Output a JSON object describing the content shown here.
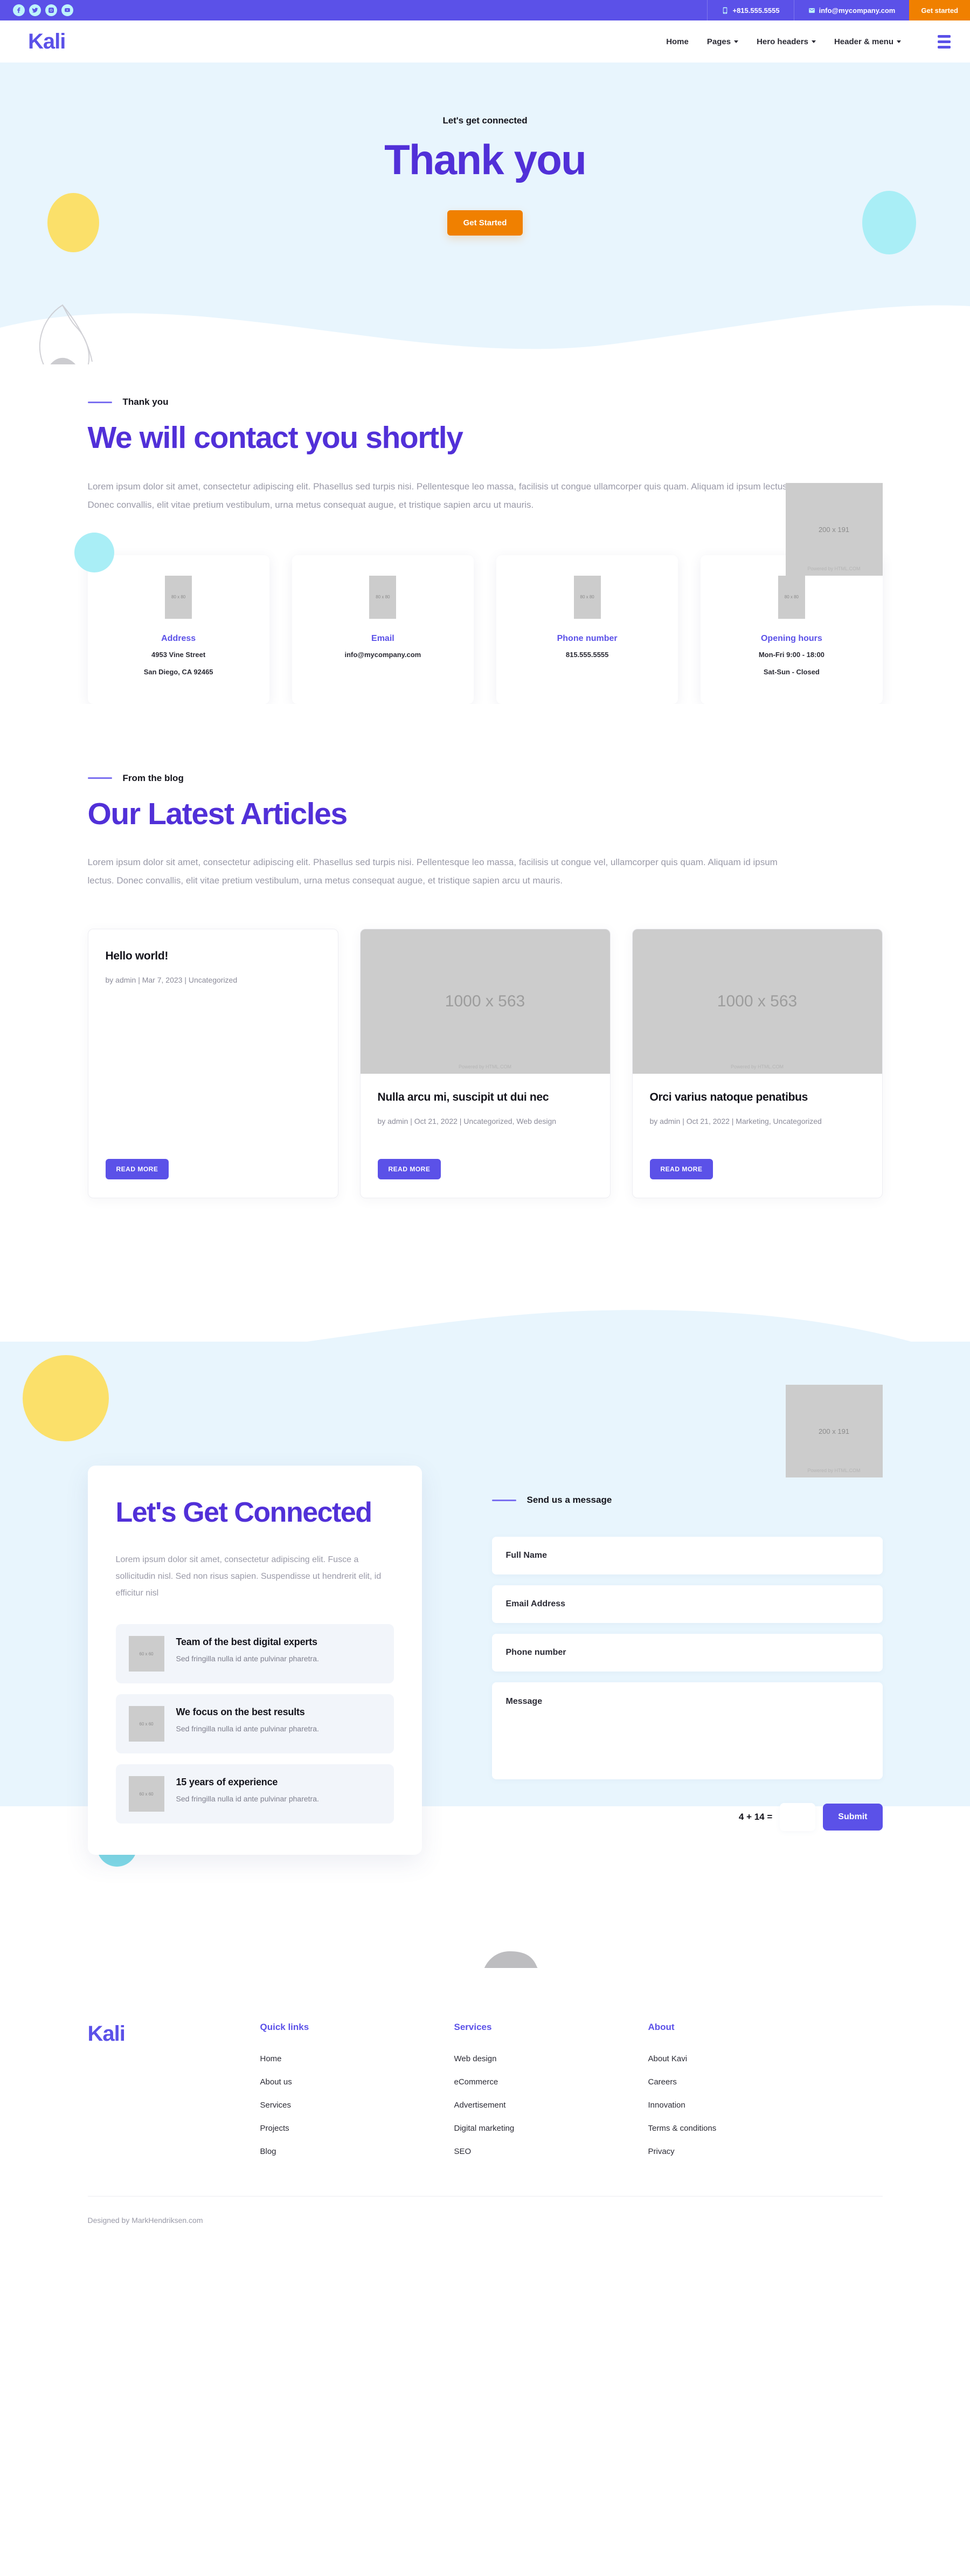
{
  "topbar": {
    "social": [
      {
        "name": "facebook-icon",
        "label": "Facebook"
      },
      {
        "name": "twitter-icon",
        "label": "Twitter"
      },
      {
        "name": "instagram-icon",
        "label": "Instagram"
      },
      {
        "name": "youtube-icon",
        "label": "YouTube"
      }
    ],
    "phone": "+815.555.5555",
    "email": "info@mycompany.com",
    "cta": "Get started",
    "bg_color": "#5b51e8",
    "cta_color": "#f08000"
  },
  "header": {
    "logo": "Kali",
    "nav": [
      {
        "label": "Home",
        "has_caret": false
      },
      {
        "label": "Pages",
        "has_caret": true
      },
      {
        "label": "Hero headers",
        "has_caret": true
      },
      {
        "label": "Header & menu",
        "has_caret": true
      }
    ]
  },
  "hero": {
    "eyebrow": "Let's get connected",
    "title": "Thank you",
    "button": "Get Started",
    "bg_color": "#e8f5fd",
    "title_color": "#5130d8"
  },
  "contact_intro": {
    "eyebrow": "Thank you",
    "heading": "We will contact you shortly",
    "paragraph": "Lorem ipsum dolor sit amet, consectetur adipiscing elit. Phasellus sed turpis nisi. Pellentesque leo massa, facilisis ut congue ullamcorper quis quam. Aliquam id ipsum lectus. Donec convallis, elit vitae pretium vestibulum, urna metus consequat augue, et tristique sapien arcu ut mauris.",
    "placeholder_image": {
      "label": "200 x 191",
      "footer": "Powered by HTML.COM"
    }
  },
  "info_cards": [
    {
      "icon_label": "80 x 80",
      "title": "Address",
      "lines": [
        "4953 Vine Street",
        "San Diego, CA 92465"
      ]
    },
    {
      "icon_label": "80 x 80",
      "title": "Email",
      "lines": [
        "info@mycompany.com"
      ]
    },
    {
      "icon_label": "80 x 80",
      "title": "Phone number",
      "lines": [
        "815.555.5555"
      ]
    },
    {
      "icon_label": "80 x 80",
      "title": "Opening hours",
      "lines": [
        "Mon-Fri 9:00 - 18:00",
        "Sat-Sun - Closed"
      ]
    }
  ],
  "blog": {
    "eyebrow": "From the blog",
    "heading": "Our Latest Articles",
    "paragraph": "Lorem ipsum dolor sit amet, consectetur adipiscing elit. Phasellus sed turpis nisi. Pellentesque leo massa, facilisis ut congue vel, ullamcorper quis quam. Aliquam id ipsum lectus. Donec convallis, elit vitae pretium vestibulum, urna metus consequat augue, et tristique sapien arcu ut mauris.",
    "posts": [
      {
        "has_thumb": false,
        "thumb_label": "",
        "thumb_footer": "",
        "title": "Hello world!",
        "meta": "by admin | Mar 7, 2023 | Uncategorized",
        "cta": "READ MORE"
      },
      {
        "has_thumb": true,
        "thumb_label": "1000 x 563",
        "thumb_footer": "Powered by HTML.COM",
        "title": "Nulla arcu mi, suscipit ut dui nec",
        "meta": "by admin | Oct 21, 2022 | Uncategorized, Web design",
        "cta": "READ MORE"
      },
      {
        "has_thumb": true,
        "thumb_label": "1000 x 563",
        "thumb_footer": "Powered by HTML.COM",
        "title": "Orci varius natoque penatibus",
        "meta": "by admin | Oct 21, 2022 | Marketing, Uncategorized",
        "cta": "READ MORE"
      }
    ]
  },
  "connect": {
    "card": {
      "heading": "Let's Get Connected",
      "paragraph": "Lorem ipsum dolor sit amet, consectetur adipiscing elit. Fusce a sollicitudin nisl. Sed non risus sapien. Suspendisse ut hendrerit elit, id efficitur nisl",
      "features": [
        {
          "icon_label": "60 x 60",
          "title": "Team of the best digital experts",
          "desc": "Sed fringilla nulla id ante pulvinar pharetra."
        },
        {
          "icon_label": "60 x 60",
          "title": "We focus on the best results",
          "desc": "Sed fringilla nulla id ante pulvinar pharetra."
        },
        {
          "icon_label": "60 x 60",
          "title": "15 years of experience",
          "desc": "Sed fringilla nulla id ante pulvinar pharetra."
        }
      ]
    },
    "form": {
      "eyebrow": "Send us a message",
      "fields": [
        {
          "name": "full-name",
          "placeholder": "Full Name",
          "value": ""
        },
        {
          "name": "email-address",
          "placeholder": "Email Address",
          "value": ""
        },
        {
          "name": "phone-number",
          "placeholder": "Phone number",
          "value": ""
        }
      ],
      "message_placeholder": "Message",
      "message_value": "",
      "captcha_question": "4 + 14 =",
      "captcha_value": "",
      "submit": "Submit"
    },
    "placeholder_image": {
      "label": "200 x 191",
      "footer": "Powered by HTML.COM"
    }
  },
  "footer": {
    "logo": "Kali",
    "columns": [
      {
        "title": "Quick links",
        "links": [
          "Home",
          "About us",
          "Services",
          "Projects",
          "Blog"
        ]
      },
      {
        "title": "Services",
        "links": [
          "Web design",
          "eCommerce",
          "Advertisement",
          "Digital marketing",
          "SEO"
        ]
      },
      {
        "title": "About",
        "links": [
          "About Kavi",
          "Careers",
          "Innovation",
          "Terms & conditions",
          "Privacy"
        ]
      }
    ],
    "credit": "Designed by MarkHendriksen.com"
  }
}
